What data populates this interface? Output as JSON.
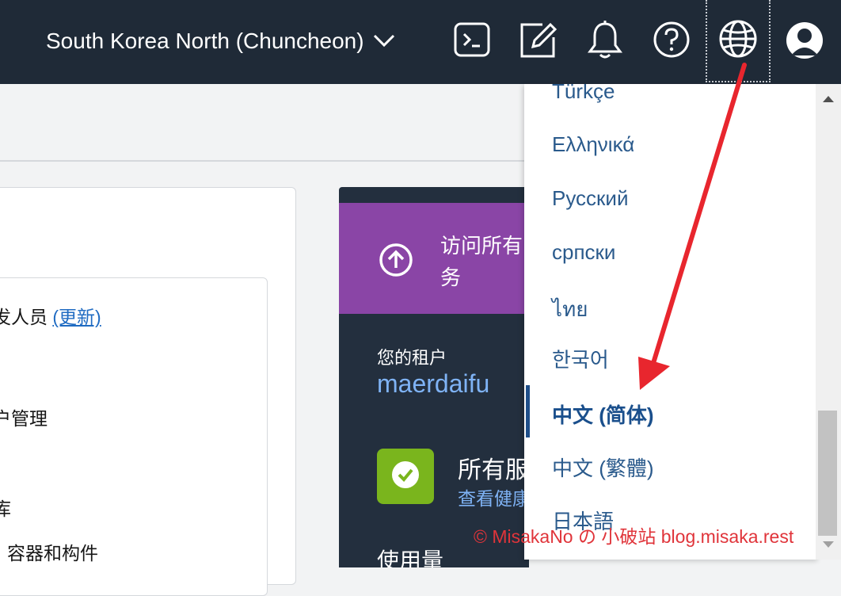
{
  "header": {
    "region_label": "South Korea North (Chuncheon)",
    "icons": [
      "chevron-down-icon",
      "terminal-icon",
      "edit-icon",
      "bell-icon",
      "help-icon",
      "globe-icon",
      "user-icon"
    ]
  },
  "left_card": {
    "line1_prefix": "发人员",
    "line1_link": "(更新)",
    "line2": "户管理",
    "line3": "库",
    "line4": "容器和构件"
  },
  "dashboard": {
    "banner_line1": "访问所有",
    "banner_line2": "务",
    "tenant_label": "您的租户",
    "tenant_name": "maerdaifu",
    "status_title": "所有服",
    "status_link": "查看健康",
    "usage_label": "使用量"
  },
  "language_menu": {
    "items": [
      "Türkçe",
      "Ελληνικά",
      "Русский",
      "српски",
      "ไทย",
      "한국어",
      "中文 (简体)",
      "中文 (繁體)",
      "日本語"
    ],
    "selected": "中文 (简体)"
  },
  "watermark": "© MisakaNo の 小破站 blog.misaka.rest",
  "colors": {
    "topbar": "#1f2a37",
    "banner": "#8a45a6",
    "dashboard": "#232f3e",
    "menu_text": "#2a5a8c",
    "status_green": "#7ab51d",
    "annotation_red": "#e8262e"
  }
}
